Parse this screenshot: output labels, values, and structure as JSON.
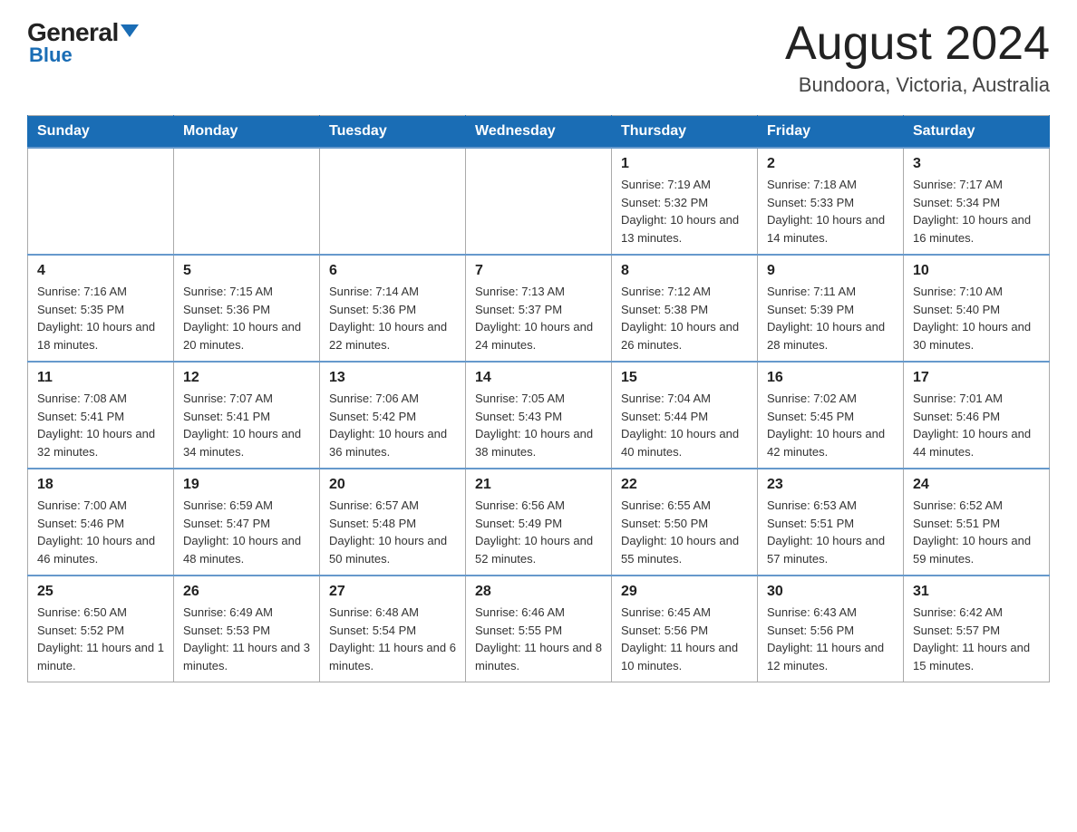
{
  "logo": {
    "general": "General",
    "triangle": "▼",
    "blue": "Blue"
  },
  "title": "August 2024",
  "subtitle": "Bundoora, Victoria, Australia",
  "days_of_week": [
    "Sunday",
    "Monday",
    "Tuesday",
    "Wednesday",
    "Thursday",
    "Friday",
    "Saturday"
  ],
  "weeks": [
    [
      {
        "day": "",
        "info": ""
      },
      {
        "day": "",
        "info": ""
      },
      {
        "day": "",
        "info": ""
      },
      {
        "day": "",
        "info": ""
      },
      {
        "day": "1",
        "info": "Sunrise: 7:19 AM\nSunset: 5:32 PM\nDaylight: 10 hours and 13 minutes."
      },
      {
        "day": "2",
        "info": "Sunrise: 7:18 AM\nSunset: 5:33 PM\nDaylight: 10 hours and 14 minutes."
      },
      {
        "day": "3",
        "info": "Sunrise: 7:17 AM\nSunset: 5:34 PM\nDaylight: 10 hours and 16 minutes."
      }
    ],
    [
      {
        "day": "4",
        "info": "Sunrise: 7:16 AM\nSunset: 5:35 PM\nDaylight: 10 hours and 18 minutes."
      },
      {
        "day": "5",
        "info": "Sunrise: 7:15 AM\nSunset: 5:36 PM\nDaylight: 10 hours and 20 minutes."
      },
      {
        "day": "6",
        "info": "Sunrise: 7:14 AM\nSunset: 5:36 PM\nDaylight: 10 hours and 22 minutes."
      },
      {
        "day": "7",
        "info": "Sunrise: 7:13 AM\nSunset: 5:37 PM\nDaylight: 10 hours and 24 minutes."
      },
      {
        "day": "8",
        "info": "Sunrise: 7:12 AM\nSunset: 5:38 PM\nDaylight: 10 hours and 26 minutes."
      },
      {
        "day": "9",
        "info": "Sunrise: 7:11 AM\nSunset: 5:39 PM\nDaylight: 10 hours and 28 minutes."
      },
      {
        "day": "10",
        "info": "Sunrise: 7:10 AM\nSunset: 5:40 PM\nDaylight: 10 hours and 30 minutes."
      }
    ],
    [
      {
        "day": "11",
        "info": "Sunrise: 7:08 AM\nSunset: 5:41 PM\nDaylight: 10 hours and 32 minutes."
      },
      {
        "day": "12",
        "info": "Sunrise: 7:07 AM\nSunset: 5:41 PM\nDaylight: 10 hours and 34 minutes."
      },
      {
        "day": "13",
        "info": "Sunrise: 7:06 AM\nSunset: 5:42 PM\nDaylight: 10 hours and 36 minutes."
      },
      {
        "day": "14",
        "info": "Sunrise: 7:05 AM\nSunset: 5:43 PM\nDaylight: 10 hours and 38 minutes."
      },
      {
        "day": "15",
        "info": "Sunrise: 7:04 AM\nSunset: 5:44 PM\nDaylight: 10 hours and 40 minutes."
      },
      {
        "day": "16",
        "info": "Sunrise: 7:02 AM\nSunset: 5:45 PM\nDaylight: 10 hours and 42 minutes."
      },
      {
        "day": "17",
        "info": "Sunrise: 7:01 AM\nSunset: 5:46 PM\nDaylight: 10 hours and 44 minutes."
      }
    ],
    [
      {
        "day": "18",
        "info": "Sunrise: 7:00 AM\nSunset: 5:46 PM\nDaylight: 10 hours and 46 minutes."
      },
      {
        "day": "19",
        "info": "Sunrise: 6:59 AM\nSunset: 5:47 PM\nDaylight: 10 hours and 48 minutes."
      },
      {
        "day": "20",
        "info": "Sunrise: 6:57 AM\nSunset: 5:48 PM\nDaylight: 10 hours and 50 minutes."
      },
      {
        "day": "21",
        "info": "Sunrise: 6:56 AM\nSunset: 5:49 PM\nDaylight: 10 hours and 52 minutes."
      },
      {
        "day": "22",
        "info": "Sunrise: 6:55 AM\nSunset: 5:50 PM\nDaylight: 10 hours and 55 minutes."
      },
      {
        "day": "23",
        "info": "Sunrise: 6:53 AM\nSunset: 5:51 PM\nDaylight: 10 hours and 57 minutes."
      },
      {
        "day": "24",
        "info": "Sunrise: 6:52 AM\nSunset: 5:51 PM\nDaylight: 10 hours and 59 minutes."
      }
    ],
    [
      {
        "day": "25",
        "info": "Sunrise: 6:50 AM\nSunset: 5:52 PM\nDaylight: 11 hours and 1 minute."
      },
      {
        "day": "26",
        "info": "Sunrise: 6:49 AM\nSunset: 5:53 PM\nDaylight: 11 hours and 3 minutes."
      },
      {
        "day": "27",
        "info": "Sunrise: 6:48 AM\nSunset: 5:54 PM\nDaylight: 11 hours and 6 minutes."
      },
      {
        "day": "28",
        "info": "Sunrise: 6:46 AM\nSunset: 5:55 PM\nDaylight: 11 hours and 8 minutes."
      },
      {
        "day": "29",
        "info": "Sunrise: 6:45 AM\nSunset: 5:56 PM\nDaylight: 11 hours and 10 minutes."
      },
      {
        "day": "30",
        "info": "Sunrise: 6:43 AM\nSunset: 5:56 PM\nDaylight: 11 hours and 12 minutes."
      },
      {
        "day": "31",
        "info": "Sunrise: 6:42 AM\nSunset: 5:57 PM\nDaylight: 11 hours and 15 minutes."
      }
    ]
  ]
}
